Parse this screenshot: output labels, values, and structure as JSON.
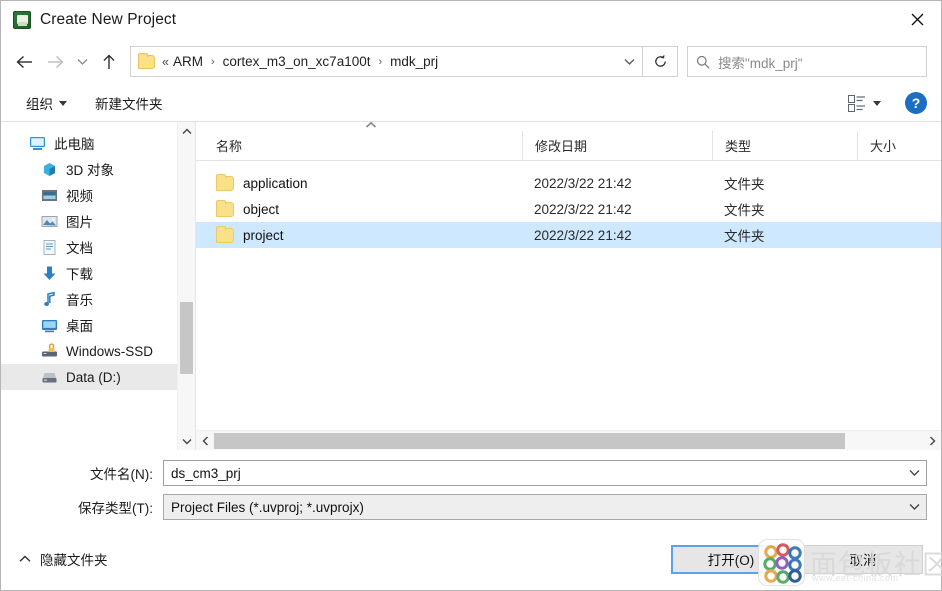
{
  "window": {
    "title": "Create New Project",
    "app_icon": "keil-uvision-icon",
    "close_icon": "close-icon"
  },
  "nav": {
    "back_icon": "back-arrow-icon",
    "forward_icon": "forward-arrow-icon",
    "recent_icon": "chevron-down-icon",
    "up_icon": "up-arrow-icon",
    "refresh_icon": "refresh-icon",
    "address_folder_icon": "folder-icon",
    "address_dropdown_icon": "chevron-down-icon",
    "breadcrumb_prefix": "«",
    "breadcrumbs": [
      "ARM",
      "cortex_m3_on_xc7a100t",
      "mdk_prj"
    ],
    "breadcrumb_separator": "›"
  },
  "search": {
    "icon": "search-icon",
    "placeholder": "搜索\"mdk_prj\""
  },
  "commandbar": {
    "organize_label": "组织",
    "organize_caret_icon": "caret-down-icon",
    "new_folder_label": "新建文件夹",
    "view_mode_icon": "view-list-icon",
    "view_mode_caret_icon": "caret-down-icon",
    "help_label": "?",
    "help_icon": "help-icon"
  },
  "sidebar": {
    "items": [
      {
        "label": "此电脑",
        "icon": "this-pc-icon",
        "indent": false,
        "hovered": false
      },
      {
        "label": "3D 对象",
        "icon": "3d-objects-icon",
        "indent": true,
        "hovered": false
      },
      {
        "label": "视频",
        "icon": "videos-icon",
        "indent": true,
        "hovered": false
      },
      {
        "label": "图片",
        "icon": "pictures-icon",
        "indent": true,
        "hovered": false
      },
      {
        "label": "文档",
        "icon": "documents-icon",
        "indent": true,
        "hovered": false
      },
      {
        "label": "下载",
        "icon": "downloads-icon",
        "indent": true,
        "hovered": false
      },
      {
        "label": "音乐",
        "icon": "music-icon",
        "indent": true,
        "hovered": false
      },
      {
        "label": "桌面",
        "icon": "desktop-icon",
        "indent": true,
        "hovered": false
      },
      {
        "label": "Windows-SSD",
        "icon": "drive-bitlocker-icon",
        "indent": true,
        "hovered": false
      },
      {
        "label": "Data (D:)",
        "icon": "drive-icon",
        "indent": true,
        "hovered": true
      }
    ],
    "scroll_up_icon": "chevron-up-icon",
    "scroll_down_icon": "chevron-down-icon"
  },
  "filelist": {
    "sort_indicator_icon": "sort-ascending-icon",
    "columns": [
      "名称",
      "修改日期",
      "类型",
      "大小"
    ],
    "rows": [
      {
        "name": "application",
        "modified": "2022/3/22 21:42",
        "type": "文件夹",
        "size": "",
        "icon": "folder-icon",
        "selected": false
      },
      {
        "name": "object",
        "modified": "2022/3/22 21:42",
        "type": "文件夹",
        "size": "",
        "icon": "folder-icon",
        "selected": false
      },
      {
        "name": "project",
        "modified": "2022/3/22 21:42",
        "type": "文件夹",
        "size": "",
        "icon": "folder-icon",
        "selected": true
      }
    ],
    "hscroll_left_icon": "chevron-left-icon",
    "hscroll_right_icon": "chevron-right-icon"
  },
  "form": {
    "filename_label": "文件名(N):",
    "filename_value": "ds_cm3_prj",
    "filename_caret_icon": "chevron-down-icon",
    "filetype_label": "保存类型(T):",
    "filetype_value": "Project Files (*.uvproj; *.uvprojx)",
    "filetype_caret_icon": "chevron-down-icon"
  },
  "footer": {
    "hide_folders_label": "隐藏文件夹",
    "hide_folders_icon": "chevron-up-icon",
    "open_label": "打开(O)",
    "cancel_label": "取消"
  },
  "watermark": {
    "text": "面包板社区",
    "subtext": "www.eet-china.com",
    "logo_icon": "breadboard-community-logo"
  },
  "colors": {
    "selection": "#cde8ff",
    "accent_blue": "#1b6ec2",
    "folder_yellow": "#fbe08a",
    "primary_border": "#5aa3e8"
  }
}
